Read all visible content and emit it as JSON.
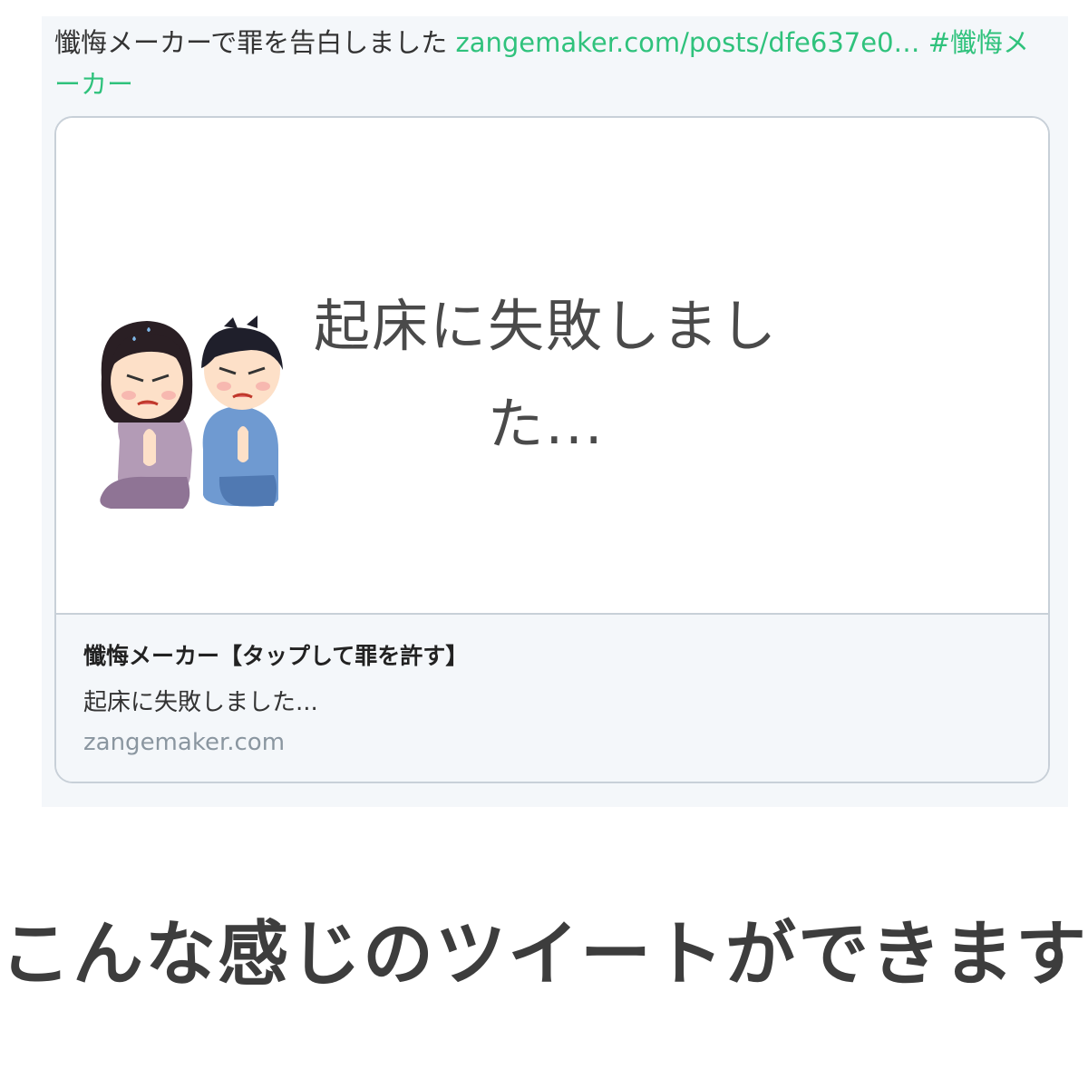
{
  "tweet": {
    "text": "懺悔メーカーで罪を告白しました ",
    "link": "zangemaker.com/posts/dfe637e0…",
    "hashtag": " #懺悔メーカー"
  },
  "card": {
    "image_text": "起床に失敗しました...",
    "title": "懺悔メーカー【タップして罪を許す】",
    "description": "起床に失敗しました...",
    "domain": "zangemaker.com"
  },
  "caption": "こんな感じのツイートができます",
  "colors": {
    "link": "#2fc27c",
    "tweet_bg": "#f4f7fa",
    "card_border": "#c8d0d8"
  }
}
